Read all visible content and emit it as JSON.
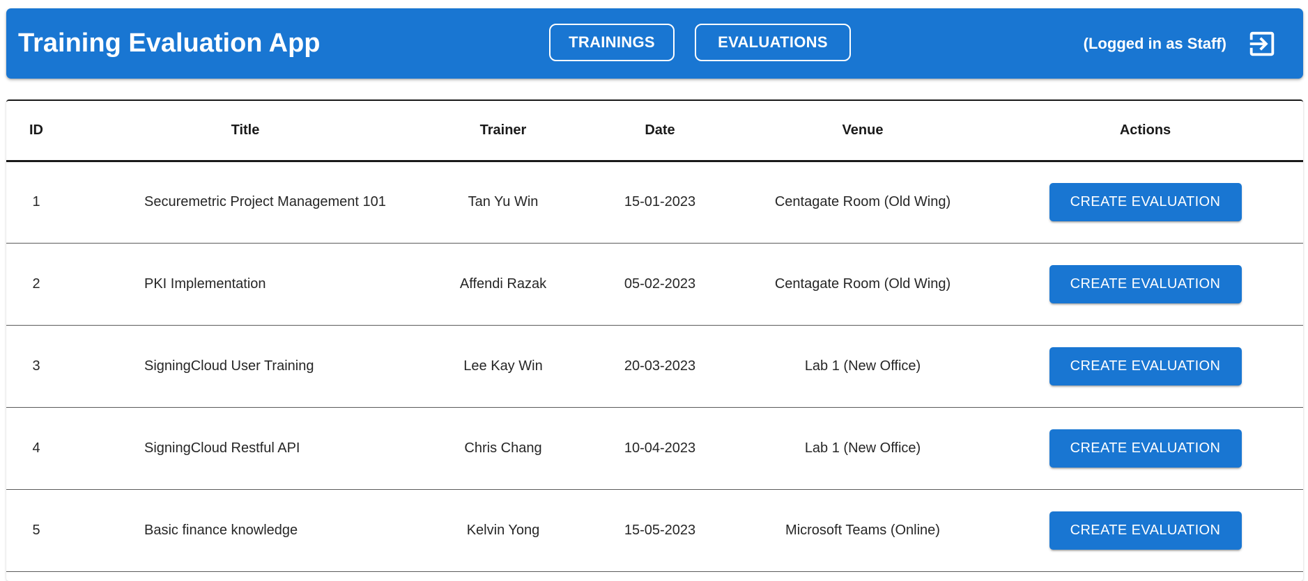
{
  "header": {
    "title": "Training Evaluation App",
    "nav": [
      {
        "label": "TRAININGS"
      },
      {
        "label": "EVALUATIONS"
      }
    ],
    "user_status": "(Logged in as Staff)",
    "logout_icon": "logout-icon"
  },
  "colors": {
    "primary": "#1976d2",
    "on_primary": "#ffffff"
  },
  "table": {
    "columns": [
      "ID",
      "Title",
      "Trainer",
      "Date",
      "Venue",
      "Actions"
    ],
    "rows": [
      {
        "id": "1",
        "title": "Securemetric Project Management 101",
        "trainer": "Tan Yu Win",
        "date": "15-01-2023",
        "venue": "Centagate Room (Old Wing)",
        "action": "CREATE EVALUATION"
      },
      {
        "id": "2",
        "title": "PKI Implementation",
        "trainer": "Affendi Razak",
        "date": "05-02-2023",
        "venue": "Centagate Room (Old Wing)",
        "action": "CREATE EVALUATION"
      },
      {
        "id": "3",
        "title": "SigningCloud User Training",
        "trainer": "Lee Kay Win",
        "date": "20-03-2023",
        "venue": "Lab 1 (New Office)",
        "action": "CREATE EVALUATION"
      },
      {
        "id": "4",
        "title": "SigningCloud Restful API",
        "trainer": "Chris Chang",
        "date": "10-04-2023",
        "venue": "Lab 1 (New Office)",
        "action": "CREATE EVALUATION"
      },
      {
        "id": "5",
        "title": "Basic finance knowledge",
        "trainer": "Kelvin Yong",
        "date": "15-05-2023",
        "venue": "Microsoft Teams (Online)",
        "action": "CREATE EVALUATION"
      }
    ]
  }
}
